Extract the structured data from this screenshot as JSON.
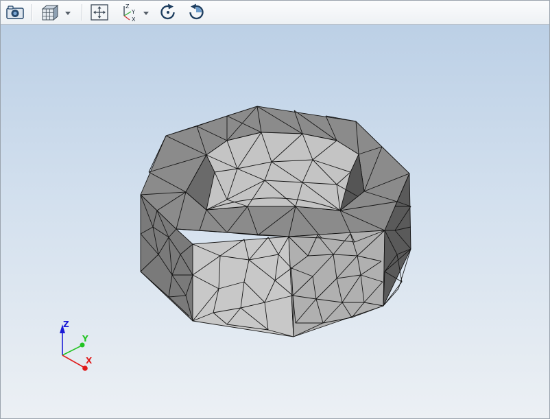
{
  "toolbar": {
    "buttons": [
      {
        "name": "screenshot-button",
        "icon": "camera-icon"
      },
      {
        "name": "view-mode-button",
        "icon": "cube-view-icon",
        "dropdown": true
      },
      {
        "name": "fit-view-button",
        "icon": "fit-to-view-icon"
      },
      {
        "name": "axis-orientation-button",
        "icon": "axes-orientation-icon",
        "dropdown": true
      },
      {
        "name": "rotate-clockwise-button",
        "icon": "rotate-cw-icon"
      },
      {
        "name": "rotate-counterclockwise-button",
        "icon": "rotate-ccw-icon"
      }
    ],
    "axes_icon_labels": {
      "z": "Z",
      "y": "Y",
      "x": "X"
    }
  },
  "viewport": {
    "model": "hex-nut-tetra-mesh",
    "background_top": "#bcd0e6",
    "background_bottom": "#ecf0f4",
    "triad": {
      "z_label": "Z",
      "y_label": "Y",
      "x_label": "X",
      "z_color": "#1a1ad6",
      "y_color": "#22c322",
      "x_color": "#e01c1c"
    }
  }
}
